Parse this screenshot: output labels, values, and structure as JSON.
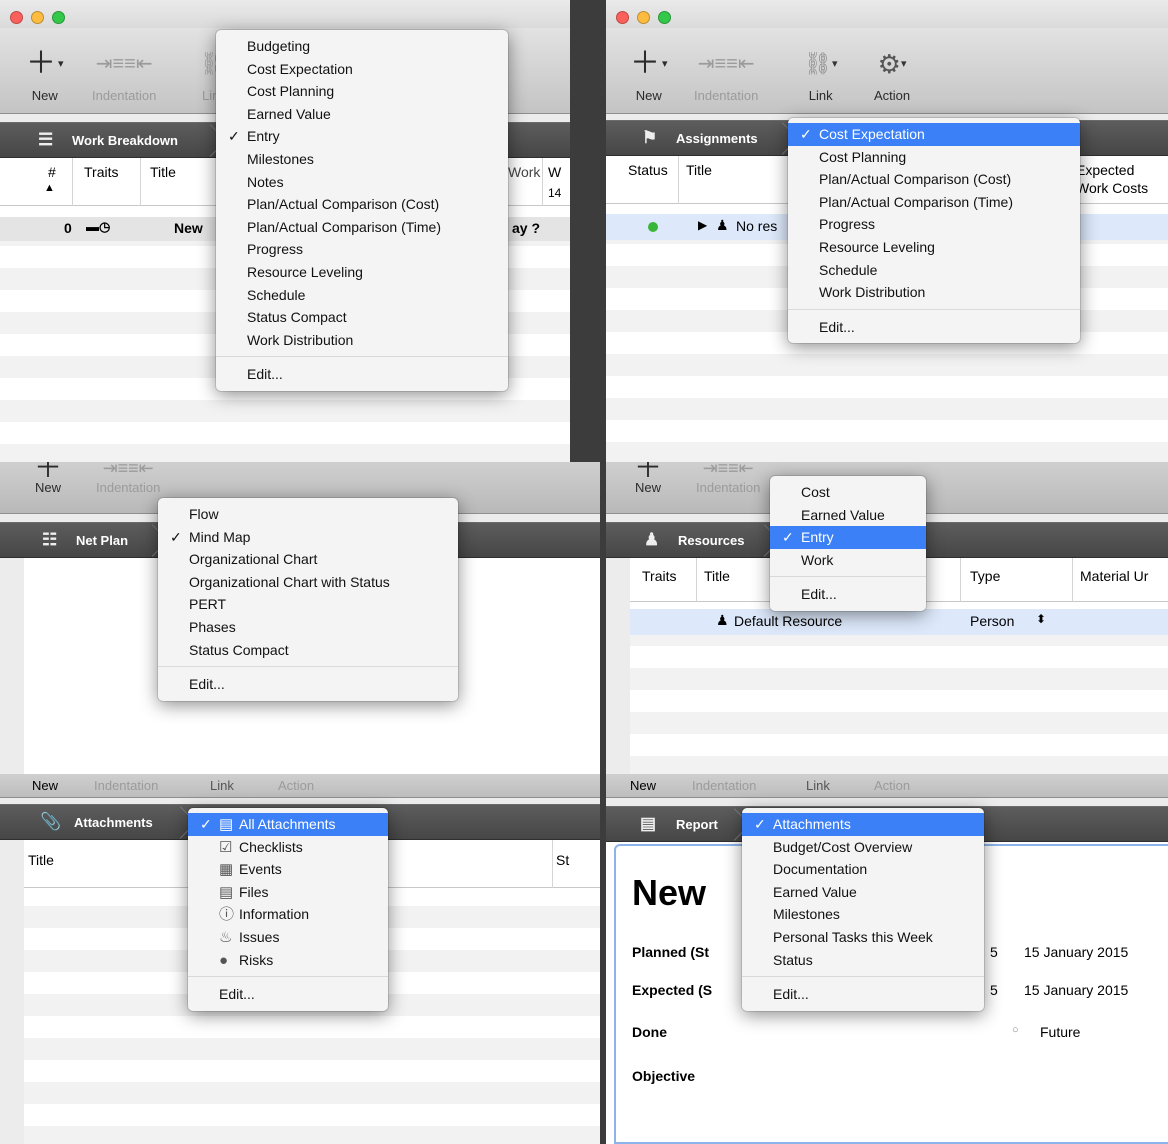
{
  "toolbar": {
    "new": "New",
    "indentation": "Indentation",
    "link": "Link",
    "action": "Action"
  },
  "p1": {
    "nav": {
      "label": "Work Breakdown"
    },
    "headers": [
      "#",
      "Traits",
      "Title",
      "Work",
      "W",
      "14"
    ],
    "row": {
      "id": "0",
      "title": "New",
      "tail": "ay ?"
    },
    "menu": {
      "items": [
        "Budgeting",
        "Cost Expectation",
        "Cost Planning",
        "Earned Value",
        "Entry",
        "Milestones",
        "Notes",
        "Plan/Actual Comparison (Cost)",
        "Plan/Actual Comparison (Time)",
        "Progress",
        "Resource Leveling",
        "Schedule",
        "Status Compact",
        "Work Distribution"
      ],
      "checked": "Entry",
      "edit": "Edit..."
    }
  },
  "p2": {
    "nav": {
      "label": "Assignments"
    },
    "headers": [
      "Status",
      "Title",
      "Expected",
      "Work Costs"
    ],
    "row": {
      "title": "No res"
    },
    "menu": {
      "items": [
        "Cost Expectation",
        "Cost Planning",
        "Plan/Actual Comparison (Cost)",
        "Plan/Actual Comparison (Time)",
        "Progress",
        "Resource Leveling",
        "Schedule",
        "Work Distribution"
      ],
      "checked": "Cost Expectation",
      "edit": "Edit..."
    }
  },
  "p3": {
    "nav": {
      "label": "Net Plan"
    },
    "menu": {
      "items": [
        "Flow",
        "Mind Map",
        "Organizational Chart",
        "Organizational Chart with Status",
        "PERT",
        "Phases",
        "Status Compact"
      ],
      "checked": "Mind Map",
      "edit": "Edit..."
    }
  },
  "p4": {
    "nav": {
      "label": "Resources"
    },
    "headers": [
      "Traits",
      "Title",
      "Type",
      "Material Ur"
    ],
    "row": {
      "title": "Default Resource",
      "type": "Person"
    },
    "menu": {
      "items": [
        "Cost",
        "Earned Value",
        "Entry",
        "Work"
      ],
      "checked": "Entry",
      "edit": "Edit..."
    }
  },
  "p5": {
    "nav": {
      "label": "Attachments"
    },
    "headers": [
      "Title",
      "St"
    ],
    "menu": {
      "items": [
        "All Attachments",
        "Checklists",
        "Events",
        "Files",
        "Information",
        "Issues",
        "Risks"
      ],
      "checked": "All Attachments",
      "edit": "Edit..."
    }
  },
  "p6": {
    "nav": {
      "label": "Report"
    },
    "report": {
      "title": "New",
      "planned": "Planned (St",
      "expected": "Expected (S",
      "done": "Done",
      "objective": "Objective",
      "date1": "15 January 2015",
      "date2": "15 January 2015",
      "future": "Future",
      "frag": "5"
    },
    "menu": {
      "items": [
        "Attachments",
        "Budget/Cost Overview",
        "Documentation",
        "Earned Value",
        "Milestones",
        "Personal Tasks this Week",
        "Status"
      ],
      "checked": "Attachments",
      "edit": "Edit..."
    }
  }
}
